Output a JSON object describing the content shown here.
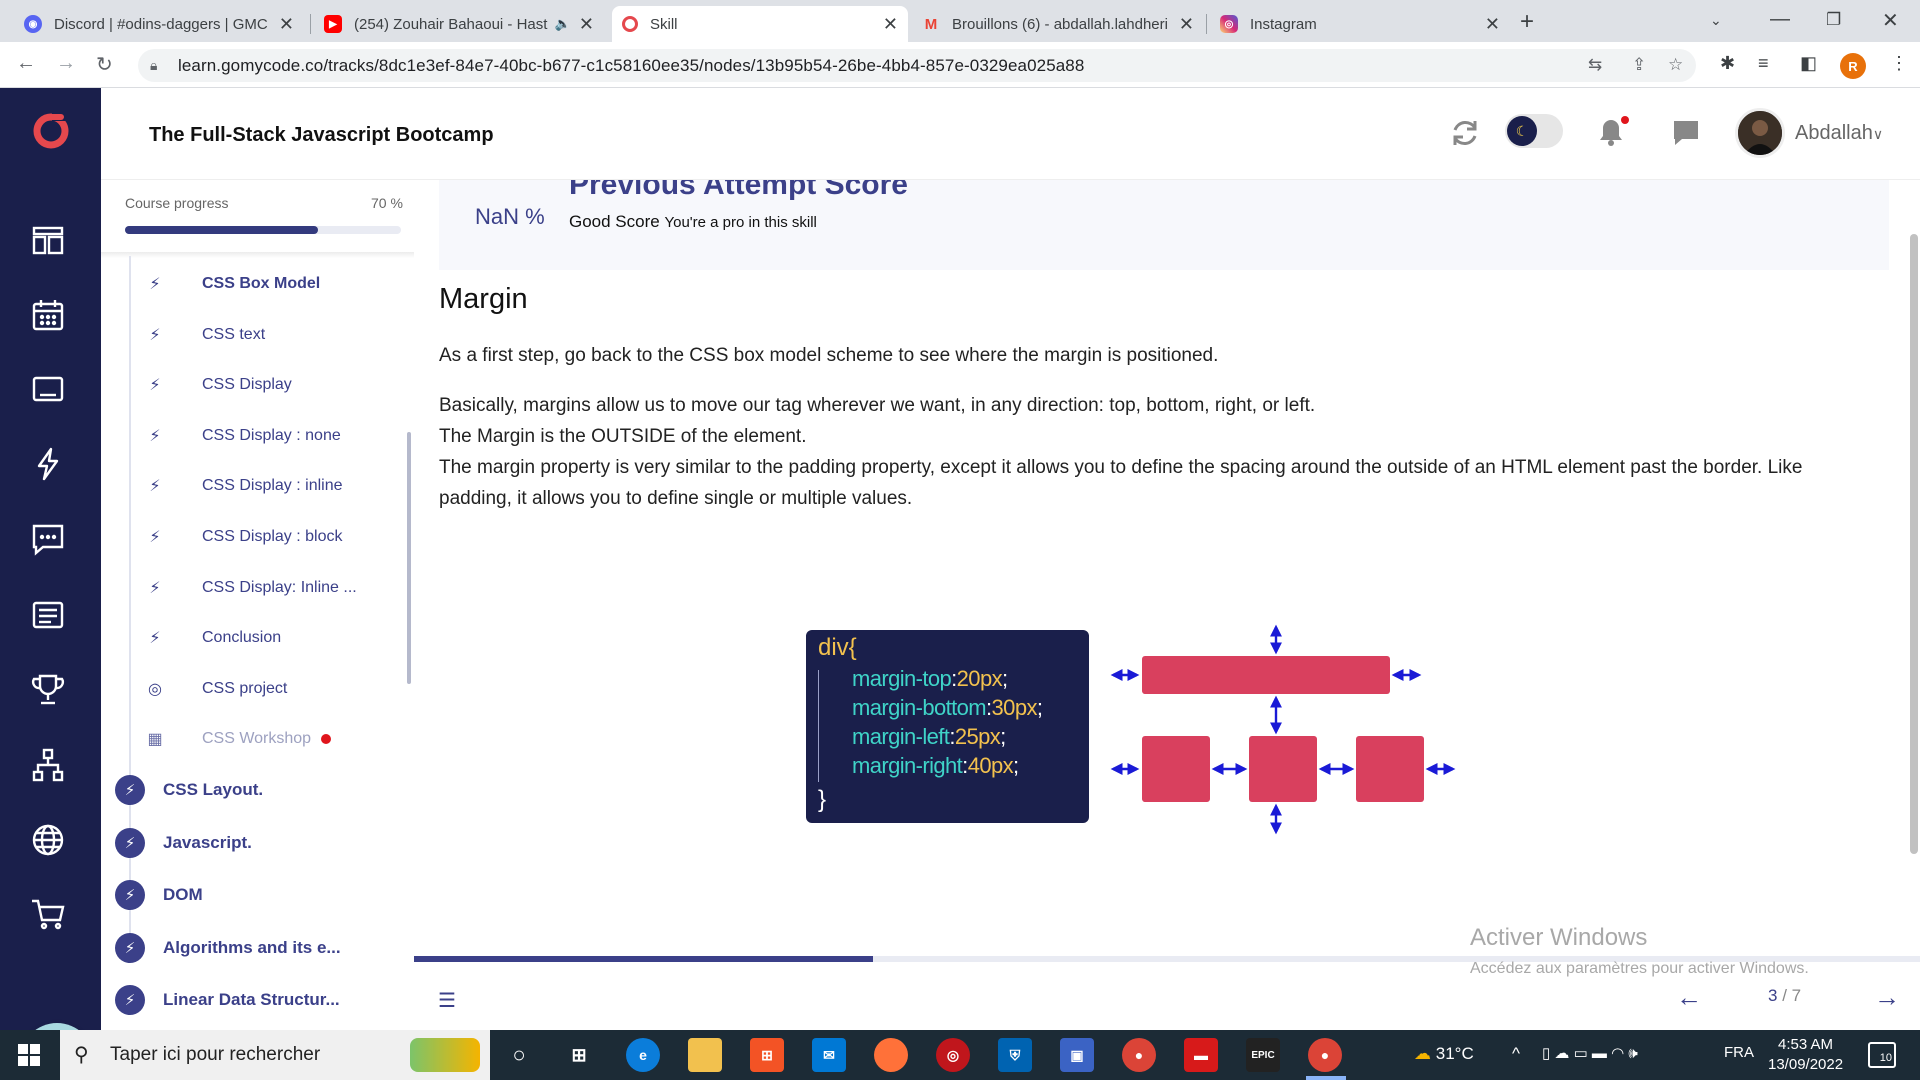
{
  "browser": {
    "tabs": [
      {
        "title": "Discord | #odins-daggers | GMC",
        "favicon_color": "#5865f2",
        "favicon": "discord-icon"
      },
      {
        "title": "(254) Zouhair Bahaoui - Hast",
        "favicon_color": "#ff0000",
        "favicon": "youtube-icon"
      },
      {
        "title": "Skill",
        "favicon_color": "#e5484d",
        "favicon": "gomycode-icon"
      },
      {
        "title": "Brouillons (6) - abdallah.lahdheri",
        "favicon_color": "#ea4335",
        "favicon": "gmail-icon"
      },
      {
        "title": "Instagram",
        "favicon_color": "#d62976",
        "favicon": "instagram-icon"
      }
    ],
    "url": "learn.gomycode.co/tracks/8dc1e3ef-84e7-40bc-b677-c1c58160ee35/nodes/13b95b54-26be-4bb4-857e-0329ea025a88",
    "profile_initial": "R"
  },
  "header": {
    "course_title": "The Full-Stack Javascript Bootcamp",
    "username": "Abdallah"
  },
  "sidebar": {
    "progress_label": "Course progress",
    "progress_text": "70 %",
    "progress_value": 0.7,
    "lessons": [
      {
        "label": "CSS Box Model",
        "icon": "bolt-icon",
        "current": true
      },
      {
        "label": "CSS text",
        "icon": "bolt-icon"
      },
      {
        "label": "CSS Display",
        "icon": "bolt-icon"
      },
      {
        "label": "CSS Display : none",
        "icon": "bolt-icon"
      },
      {
        "label": "CSS Display : inline",
        "icon": "bolt-icon"
      },
      {
        "label": "CSS Display : block",
        "icon": "bolt-icon"
      },
      {
        "label": "CSS Display: Inline ...",
        "icon": "bolt-icon"
      },
      {
        "label": "Conclusion",
        "icon": "bolt-icon"
      },
      {
        "label": "CSS project",
        "icon": "target-icon"
      },
      {
        "label": "CSS Workshop",
        "icon": "workshop-icon",
        "faded": true,
        "red_dot": true
      }
    ],
    "modules": [
      {
        "label": "CSS Layout."
      },
      {
        "label": "Javascript."
      },
      {
        "label": "DOM"
      },
      {
        "label": "Algorithms and its e..."
      },
      {
        "label": "Linear Data Structur..."
      }
    ]
  },
  "content": {
    "score": {
      "value": "NaN %",
      "title": "Previous Attempt Score",
      "good": "Good Score",
      "good_sub": "You're a pro in this skill"
    },
    "section_title": "Margin",
    "paragraphs": [
      "As a first step, go back to the CSS box model scheme to see where the margin is positioned.",
      "Basically, margins allow us to move our tag wherever we want, in any direction: top, bottom, right, or left.",
      "The Margin is the OUTSIDE of the element.",
      "The margin property is very similar to the padding property, except it allows you to define the spacing around the outside of an HTML element past the border. Like padding, it allows you to define single or multiple values."
    ],
    "code": {
      "open": "div{",
      "lines": [
        {
          "prop": "margin-top",
          "value": "20px"
        },
        {
          "prop": "margin-bottom",
          "value": "30px"
        },
        {
          "prop": "margin-left",
          "value": "25px"
        },
        {
          "prop": "margin-right",
          "value": "40px"
        }
      ],
      "close": "}"
    },
    "content_progress": 0.305,
    "page_current": "3",
    "page_total": "/ 7"
  },
  "activation": {
    "title": "Activer Windows",
    "subtitle": "Accédez aux paramètres pour activer Windows."
  },
  "taskbar": {
    "search_placeholder": "Taper ici pour rechercher",
    "weather": "31°C",
    "lang": "FRA",
    "time": "4:53 AM",
    "date": "13/09/2022",
    "notifications": "10"
  },
  "colors": {
    "rail": "#1a1f4b",
    "accent": "#3b4089",
    "brand_red": "#e5484d",
    "box_pink": "#d9405e",
    "arrow_blue": "#1a1ad6",
    "code_bg": "#1a1f4b",
    "code_prop": "#3fd4c8",
    "code_value": "#f2c14e"
  }
}
